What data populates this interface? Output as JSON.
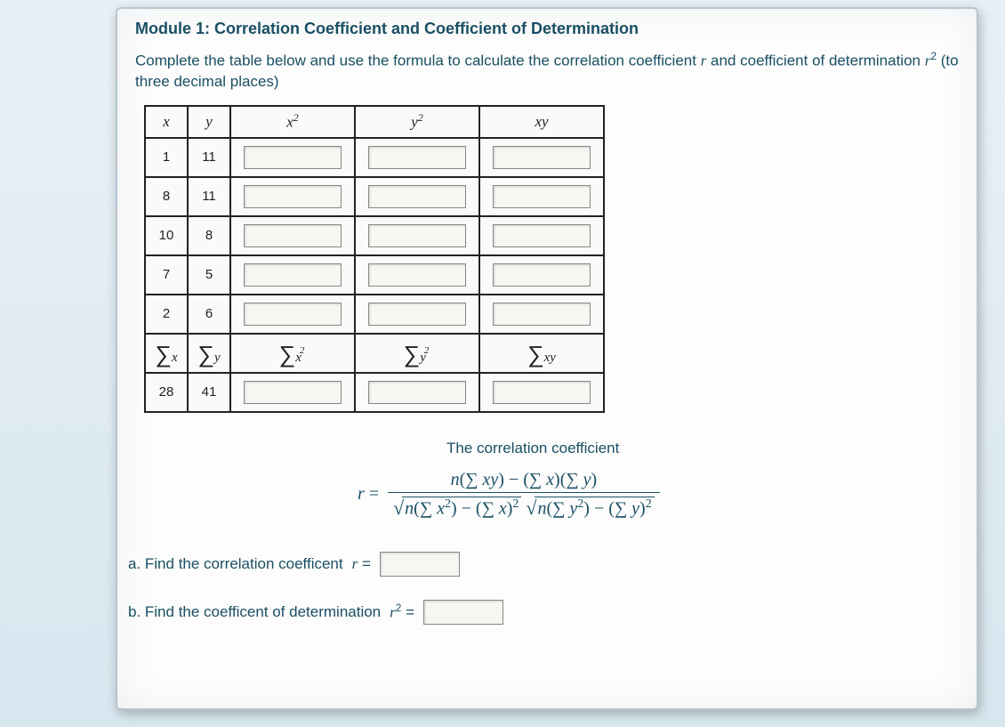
{
  "module_title": "Module 1: Correlation Coefficient and Coefficient of Determination",
  "instructions_parts": {
    "p1": "Complete the table below and use the formula to calculate the correlation coefficient ",
    "p2": " and coefficient of determination ",
    "p3": " (to three decimal places)"
  },
  "headers": {
    "x": "x",
    "y": "y",
    "x2": "x²",
    "y2": "y²",
    "xy": "xy"
  },
  "rows": [
    {
      "x": "1",
      "y": "11"
    },
    {
      "x": "8",
      "y": "11"
    },
    {
      "x": "10",
      "y": "8"
    },
    {
      "x": "7",
      "y": "5"
    },
    {
      "x": "2",
      "y": "6"
    }
  ],
  "sigma_labels": {
    "sx": "∑ x",
    "sy": "∑ y",
    "sx2": "∑ x²",
    "sy2": "∑ y²",
    "sxy": "∑ xy"
  },
  "sums": {
    "x": "28",
    "y": "41"
  },
  "formula_caption": "The correlation coefficient",
  "formula": {
    "lhs": "r =",
    "num": "n(∑ xy) − (∑ x)(∑ y)",
    "den1": "n(∑ x²) − (∑ x)²",
    "den2": "n(∑ y²) − (∑ y)²"
  },
  "questions": {
    "a": "a. Find the correlation coefficent ",
    "a_sym": "r =",
    "b": "b. Find the coefficent of determination ",
    "b_sym": "r² ="
  }
}
